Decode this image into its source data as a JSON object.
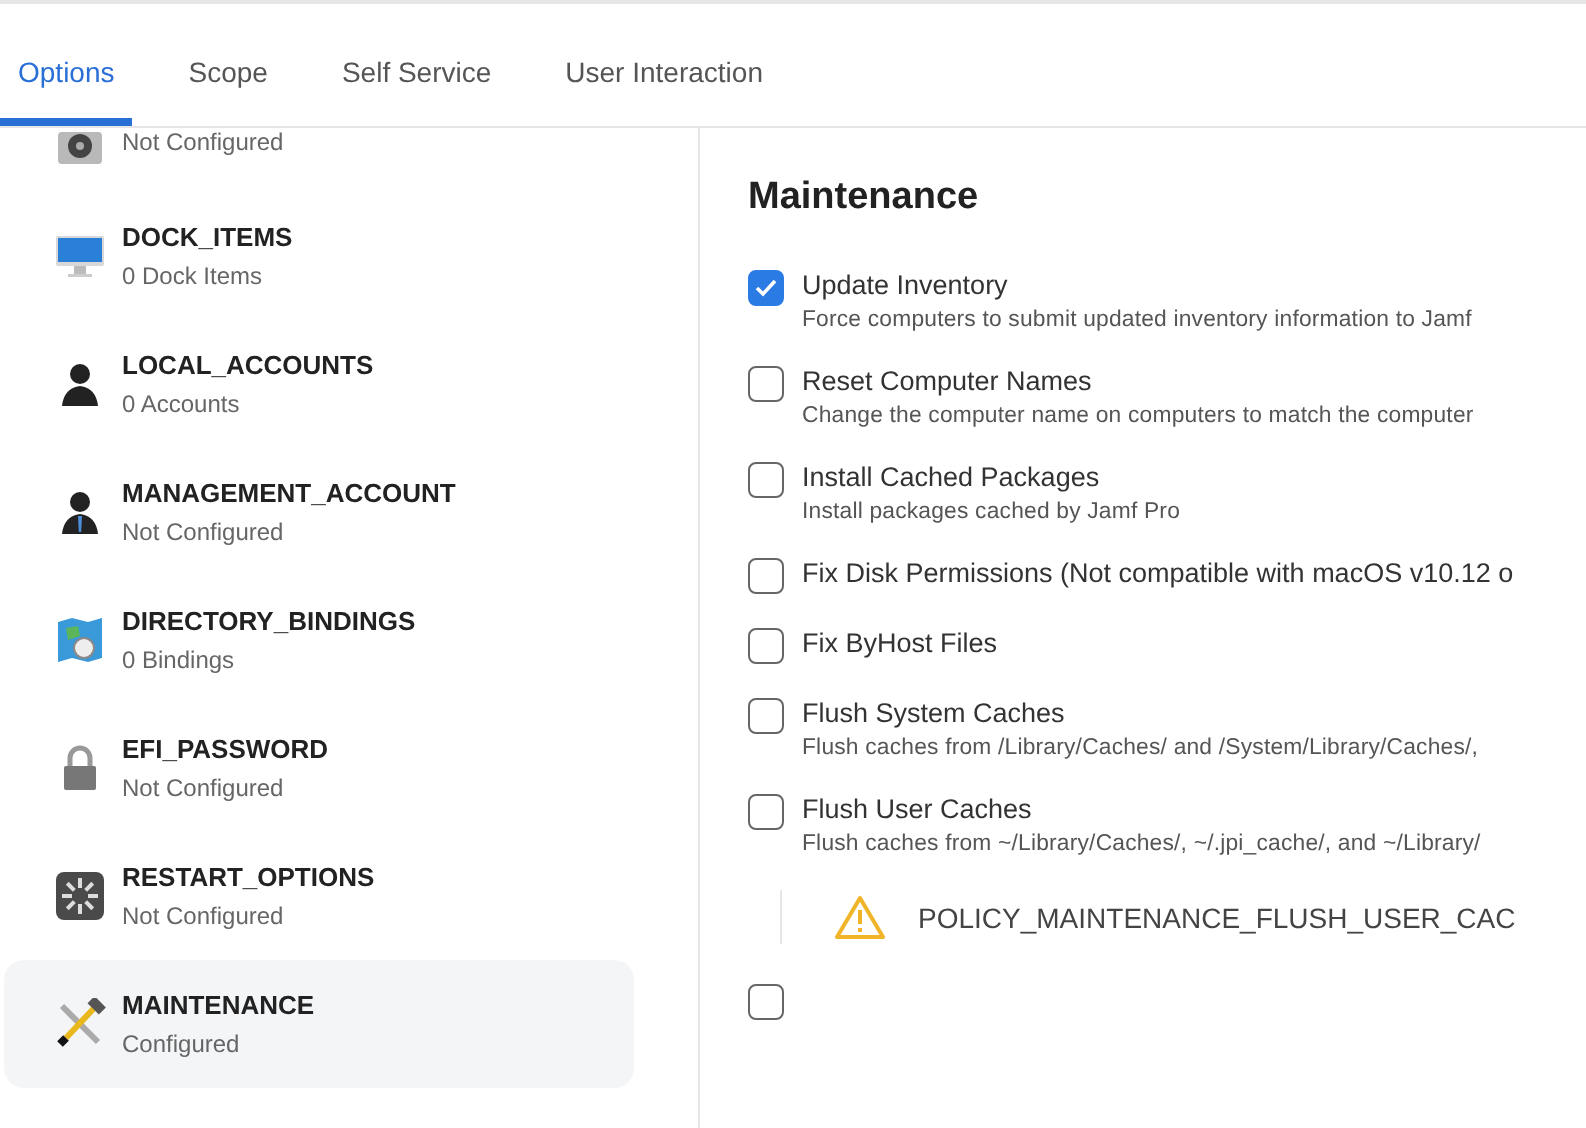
{
  "tabs": [
    {
      "label": "Options",
      "selected": true
    },
    {
      "label": "Scope",
      "selected": false
    },
    {
      "label": "Self Service",
      "selected": false
    },
    {
      "label": "User Interaction",
      "selected": false
    }
  ],
  "sidebar": {
    "items": [
      {
        "kind": "disk",
        "subtitle": "Not Configured",
        "selected": false
      },
      {
        "kind": "monitor",
        "title": "DOCK_ITEMS",
        "subtitle": "0 Dock Items",
        "selected": false
      },
      {
        "kind": "person",
        "title": "LOCAL_ACCOUNTS",
        "subtitle": "0 Accounts",
        "selected": false
      },
      {
        "kind": "manager",
        "title": "MANAGEMENT_ACCOUNT",
        "subtitle": "Not Configured",
        "selected": false
      },
      {
        "kind": "map",
        "title": "DIRECTORY_BINDINGS",
        "subtitle": "0 Bindings",
        "selected": false
      },
      {
        "kind": "lock",
        "title": "EFI_PASSWORD",
        "subtitle": "Not Configured",
        "selected": false
      },
      {
        "kind": "spinner",
        "title": "RESTART_OPTIONS",
        "subtitle": "Not Configured",
        "selected": false
      },
      {
        "kind": "tools",
        "title": "MAINTENANCE",
        "subtitle": "Configured",
        "selected": true
      }
    ]
  },
  "panel": {
    "heading": "Maintenance",
    "options": [
      {
        "kind": "checkbox",
        "label": "Update Inventory",
        "description": "Force computers to submit updated inventory information to Jamf",
        "checked": true
      },
      {
        "kind": "checkbox",
        "label": "Reset Computer Names",
        "description": "Change the computer name on computers to match the computer",
        "checked": false
      },
      {
        "kind": "checkbox",
        "label": "Install Cached Packages",
        "description": "Install packages cached by Jamf Pro",
        "checked": false
      },
      {
        "kind": "checkbox",
        "label": "Fix Disk Permissions (Not compatible with macOS v10.12 o",
        "checked": false
      },
      {
        "kind": "checkbox",
        "label": "Fix ByHost Files",
        "checked": false
      },
      {
        "kind": "checkbox",
        "label": "Flush System Caches",
        "description": "Flush caches from /Library/Caches/ and /System/Library/Caches/,",
        "checked": false
      },
      {
        "kind": "checkbox",
        "label": "Flush User Caches",
        "description": "Flush caches from ~/Library/Caches/, ~/.jpi_cache/, and ~/Library/",
        "checked": false
      },
      {
        "kind": "warning",
        "text": "POLICY_MAINTENANCE_FLUSH_USER_CAC"
      },
      {
        "kind": "checkbox",
        "checked": false
      }
    ]
  }
}
